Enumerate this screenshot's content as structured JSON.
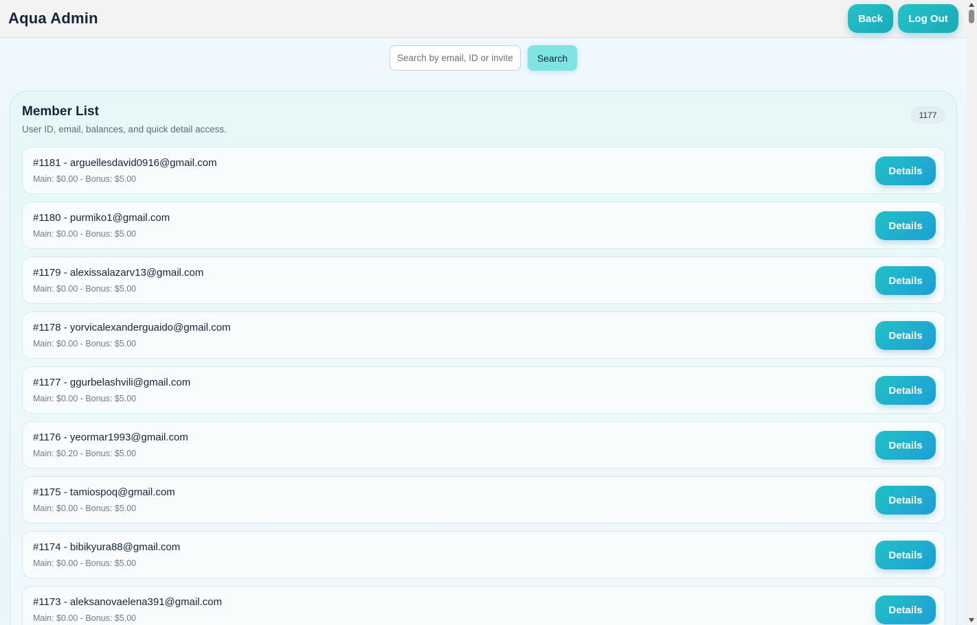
{
  "app": {
    "title": "Aqua Admin"
  },
  "header": {
    "back_label": "Back",
    "logout_label": "Log Out"
  },
  "search": {
    "placeholder": "Search by email, ID or invite",
    "value": "",
    "button_label": "Search"
  },
  "panel": {
    "title": "Member List",
    "subtitle": "User ID, email, balances, and quick detail access.",
    "count": "1177"
  },
  "members": [
    {
      "title": "#1181 - arguellesdavid0916@gmail.com",
      "balances": "Main: $0.00 - Bonus: $5.00",
      "action": "Details"
    },
    {
      "title": "#1180 - purmiko1@gmail.com",
      "balances": "Main: $0.00 - Bonus: $5.00",
      "action": "Details"
    },
    {
      "title": "#1179 - alexissalazarv13@gmail.com",
      "balances": "Main: $0.00 - Bonus: $5.00",
      "action": "Details"
    },
    {
      "title": "#1178 - yorvicalexanderguaido@gmail.com",
      "balances": "Main: $0.00 - Bonus: $5.00",
      "action": "Details"
    },
    {
      "title": "#1177 - ggurbelashvili@gmail.com",
      "balances": "Main: $0.00 - Bonus: $5.00",
      "action": "Details"
    },
    {
      "title": "#1176 - yeormar1993@gmail.com",
      "balances": "Main: $0.20 - Bonus: $5.00",
      "action": "Details"
    },
    {
      "title": "#1175 - tamiospoq@gmail.com",
      "balances": "Main: $0.00 - Bonus: $5.00",
      "action": "Details"
    },
    {
      "title": "#1174 - bibikyura88@gmail.com",
      "balances": "Main: $0.00 - Bonus: $5.00",
      "action": "Details"
    },
    {
      "title": "#1173 - aleksanovaelena391@gmail.com",
      "balances": "Main: $0.00 - Bonus: $5.00",
      "action": "Details"
    }
  ],
  "colors": {
    "accent": "#1fb6c8",
    "header_bg": "#f3f3f3",
    "page_bg": "#eef8fd",
    "search_button_bg": "#7ee5e2"
  }
}
